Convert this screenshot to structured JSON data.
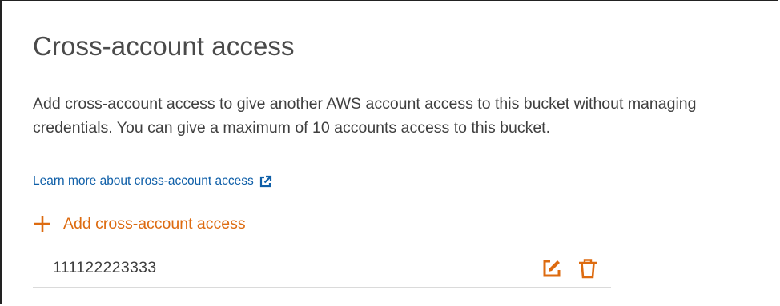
{
  "section": {
    "title": "Cross-account access",
    "description": "Add cross-account access to give another AWS account access to this bucket without managing credentials. You can give a maximum of 10 accounts access to this bucket.",
    "learn_more_label": "Learn more about cross-account access",
    "learn_more_icon": "external-link-icon",
    "add_label": "Add cross-account access",
    "add_icon": "plus-icon"
  },
  "accounts": [
    {
      "id": "111122223333",
      "edit_icon": "edit-icon",
      "delete_icon": "trash-icon"
    }
  ],
  "colors": {
    "link": "#0f5fa8",
    "accent": "#dd6b10",
    "text": "#3f3f3f",
    "divider": "#dadada"
  }
}
